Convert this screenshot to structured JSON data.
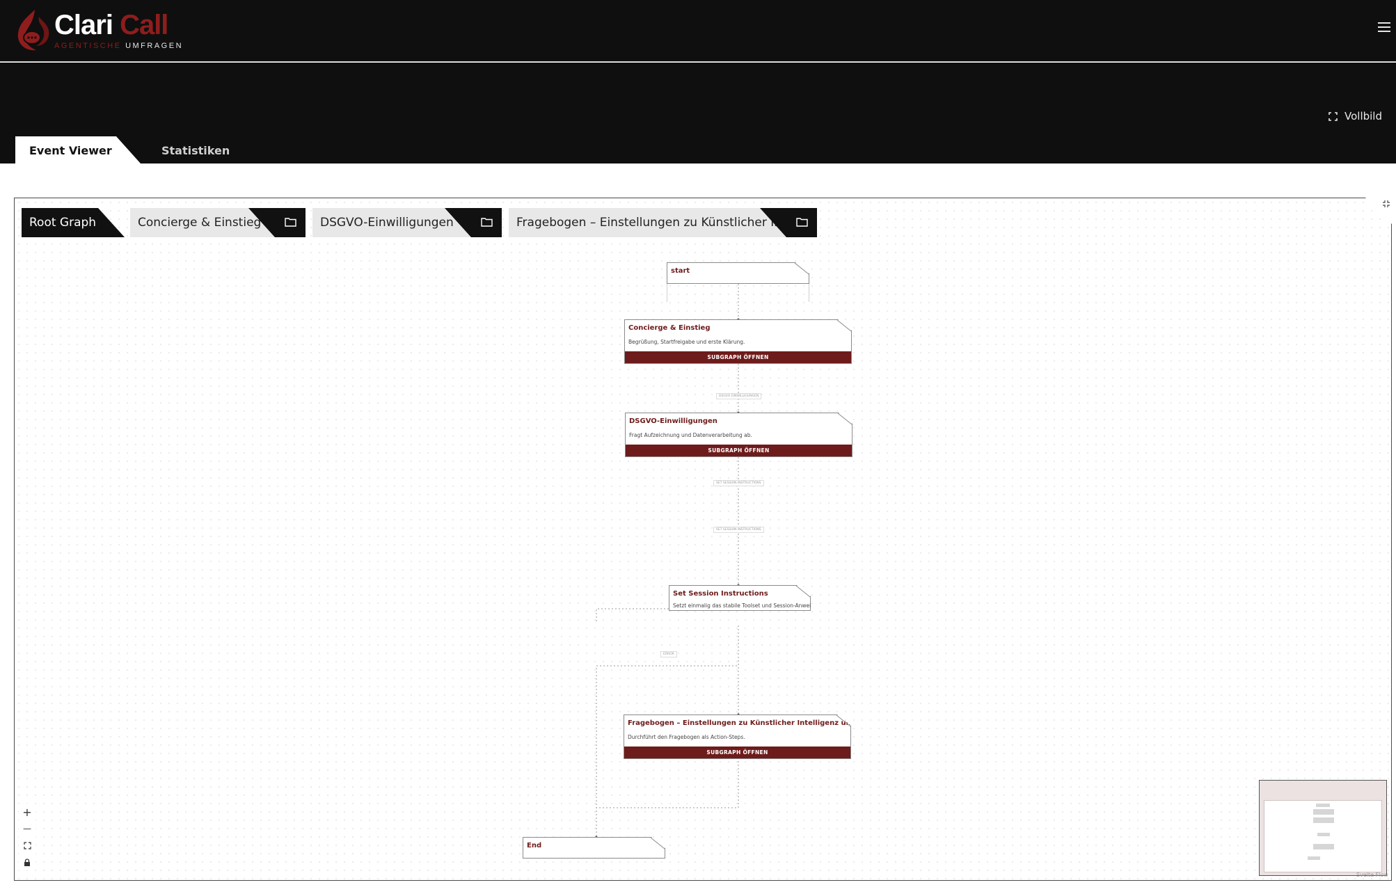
{
  "brand": {
    "name_part1": "Clari",
    "name_part2": "Call",
    "tagline_part1": "AGENTISCHE",
    "tagline_part2": "UMFRAGEN",
    "accent_color": "#8f1d1d"
  },
  "header": {
    "fullscreen_label": "Vollbild",
    "menu_icon": "hamburger-icon"
  },
  "tabs": [
    {
      "label": "Event Viewer",
      "active": true
    },
    {
      "label": "Statistiken",
      "active": false
    }
  ],
  "breadcrumbs": [
    {
      "label": "Root Graph",
      "active": true
    },
    {
      "label": "Concierge & Einstieg",
      "icon": "folder-icon"
    },
    {
      "label": "DSGVO-Einwilligungen",
      "icon": "folder-icon"
    },
    {
      "label": "Fragebogen – Einstellungen zu Künstlicher Int...",
      "icon": "folder-icon"
    }
  ],
  "nodes": {
    "start": {
      "title": "start"
    },
    "concierge": {
      "title": "Concierge & Einstieg",
      "description": "Begrüßung, Startfreigabe und erste Klärung.",
      "button": "SUBGRAPH ÖFFNEN"
    },
    "dsgvo": {
      "title": "DSGVO-Einwilligungen",
      "description": "Fragt Aufzeichnung und Datenverarbeitung ab.",
      "button": "SUBGRAPH ÖFFNEN"
    },
    "session": {
      "title": "Set Session Instructions",
      "description": "Setzt einmalig das stabile Toolset und Session-Anweisungen."
    },
    "fragebogen": {
      "title": "Fragebogen – Einstellungen zu Künstlicher Intelligenz und KI im Radio",
      "description": "Durchführt den Fragebogen als Action-Steps.",
      "button": "SUBGRAPH ÖFFNEN"
    },
    "end": {
      "title": "End"
    }
  },
  "edge_labels": {
    "e1": "DSGVO EINWILLIGUNGEN",
    "e2": "SET SESSION INSTRUCTIONS",
    "e3": "SET SESSION INSTRUCTIONS",
    "e4": "ERROR"
  },
  "controls": {
    "zoom_in": "+",
    "zoom_out": "—"
  },
  "attribution": "Svelte Flow"
}
